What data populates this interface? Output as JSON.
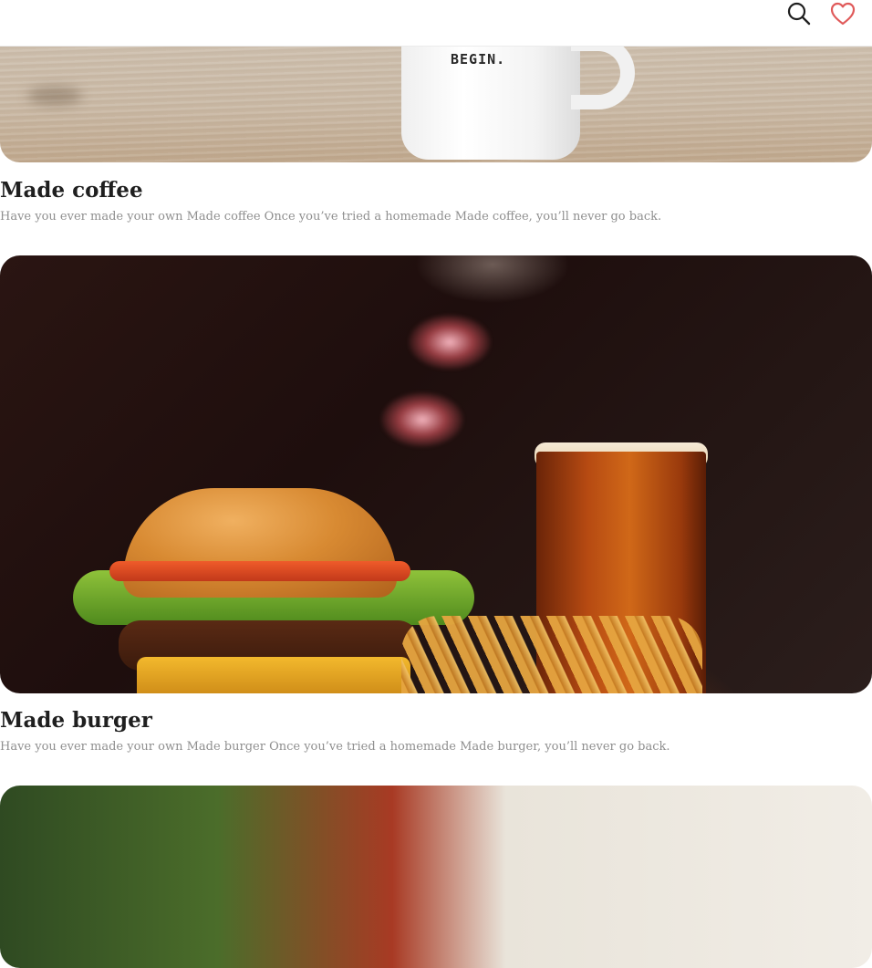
{
  "header": {
    "icons": [
      "search-icon",
      "heart-icon"
    ],
    "accent_color": "#e05a5a"
  },
  "cards": [
    {
      "title": "Made coffee",
      "description": "Have you ever made your own Made coffee Once you’ve tried a homemade Made coffee, you’ll never go back.",
      "image_text": "BEGIN."
    },
    {
      "title": "Made burger",
      "description": "Have you ever made your own Made burger Once you’ve tried a homemade Made burger, you’ll never go back."
    }
  ]
}
